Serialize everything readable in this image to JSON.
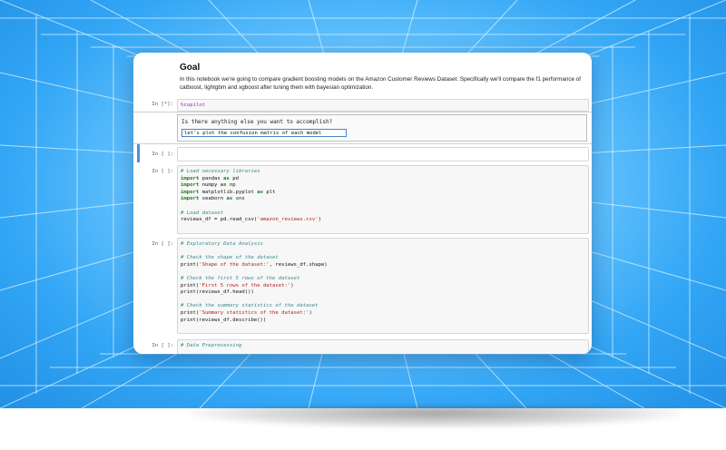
{
  "notebook": {
    "goal_title": "Goal",
    "goal_text": "In this notebook we're going to compare gradient boosting models on the Amazon Customer Reviews Dataset. Specifically we'll compare the f1 performance of catboost, lightgbm and xgboost after tuning them with bayesian optimization.",
    "copilot_cell": {
      "prompt": "In [*]:",
      "magic": "%copilot",
      "question": "Is there anything else you want to accomplish?",
      "input_value": "let's plot the confusion matrix of each model"
    },
    "empty_cell": {
      "prompt": "In [ ]:"
    },
    "cell_imports": {
      "prompt": "In [ ]:",
      "comment1": "# Load necessary libraries",
      "line1_kw": "import",
      "line1_mod": " pandas ",
      "line1_as": "as",
      "line1_alias": " pd",
      "line2_kw": "import",
      "line2_mod": " numpy ",
      "line2_as": "as",
      "line2_alias": " np",
      "line3_kw": "import",
      "line3_mod": " matplotlib.pyplot ",
      "line3_as": "as",
      "line3_alias": " plt",
      "line4_kw": "import",
      "line4_mod": " seaborn ",
      "line4_as": "as",
      "line4_alias": " sns",
      "comment2": "# Load dataset",
      "read_prefix": "reviews_df = pd.read_csv(",
      "read_arg": "'amazon_reviews.csv'",
      "read_suffix": ")"
    },
    "cell_eda": {
      "prompt": "In [ ]:",
      "comment1": "# Exploratory Data Analysis",
      "comment2": "# Check the shape of the dataset",
      "print1_prefix": "print(",
      "print1_arg": "'Shape of the dataset:'",
      "print1_suffix": ", reviews_df.shape)",
      "comment3": "# Check the first 5 rows of the dataset",
      "print2_prefix": "print(",
      "print2_arg": "'First 5 rows of the dataset:'",
      "print2_suffix": ")",
      "print3": "print(reviews_df.head())",
      "comment4": "# Check the summary statistics of the dataset",
      "print4_prefix": "print(",
      "print4_arg": "'Summary statistics of the dataset:'",
      "print4_suffix": ")",
      "print5": "print(reviews_df.describe())"
    },
    "cell_preprocess": {
      "prompt": "In [ ]:",
      "comment1": "# Data Preprocessing"
    }
  },
  "colors": {
    "backdrop": "#33a6f5",
    "grid_line": "#d9f3ff",
    "comment": "#3a8a8a",
    "keyword": "#1c7a1c",
    "string": "#b22222",
    "selection": "#4a90e2"
  }
}
